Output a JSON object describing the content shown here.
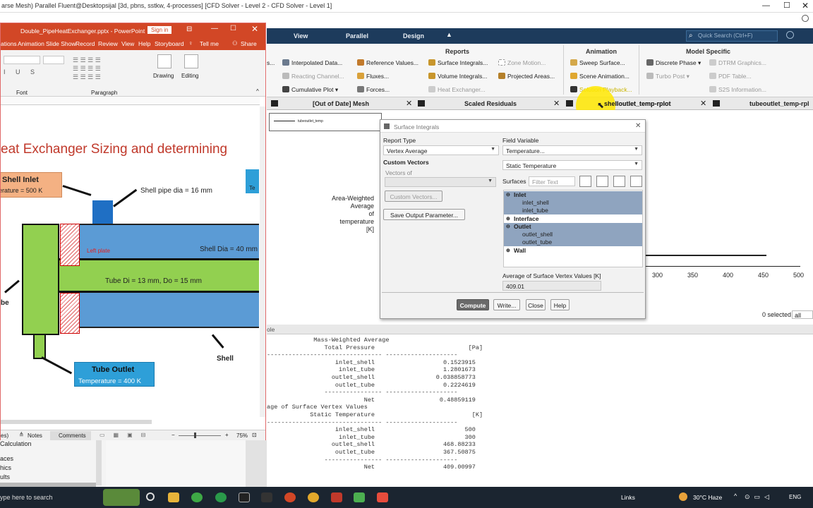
{
  "window_title": "arse Mesh) Parallel Fluent@Desktopsijal  [3d, pbns, sstkw, 4-processes] [CFD Solver - Level 2 - CFD Solver - Level 1]",
  "fluent": {
    "ribbon_tabs": [
      "View",
      "Parallel",
      "Design"
    ],
    "quick_search_placeholder": "Quick Search (Ctrl+F)",
    "groups": {
      "reports": "Reports",
      "animation": "Animation",
      "model_specific": "Model Specific"
    },
    "ribbon_items": {
      "interpolated_data": "Interpolated Data...",
      "reacting_channel": "Reacting Channel...",
      "cumulative_plot": "Cumulative Plot",
      "reference_values": "Reference Values...",
      "fluxes": "Fluxes...",
      "forces": "Forces...",
      "surface_integrals": "Surface Integrals...",
      "volume_integrals": "Volume Integrals...",
      "heat_exchanger": "Heat Exchanger...",
      "zone_motion": "Zone Motion...",
      "projected_areas": "Projected Areas...",
      "sweep_surface": "Sweep Surface...",
      "scene_animation": "Scene Animation...",
      "solution_playback": "Solution Playback...",
      "discrete_phase": "Discrete Phase",
      "turbo_post": "Turbo Post",
      "dtrm_graphics": "DTRM Graphics...",
      "pdf_table": "PDF Table...",
      "s2s_information": "S2S Information..."
    },
    "graphics_tabs": [
      "[Out of Date] Mesh",
      "Scaled Residuals",
      "shelloutlet_temp-rplot",
      "tubeoutlet_temp-rpl"
    ],
    "plot": {
      "legend_label": "tubeoutlet_temp",
      "ylabel_lines": [
        "Area-Weighted",
        "Average",
        "of",
        "temperature",
        "[K]"
      ],
      "x_ticks": [
        "300",
        "350",
        "400",
        "450",
        "500"
      ],
      "selected_text": "0 selected",
      "selected_filter": "all"
    },
    "console": {
      "header": "ole",
      "lines": [
        "             Mass-Weighted Average",
        "                Total Pressure                          [Pa]",
        "-------------------------------- --------------------",
        "                   inlet_shell                   0.1523915",
        "                    inlet_tube                   1.2801673",
        "                  outlet_shell                 0.038858773",
        "                   outlet_tube                   0.2224619",
        "                ---------------- --------------------",
        "                           Net                  0.48859119",
        "",
        "age of Surface Vertex Values",
        "            Static Temperature                           [K]",
        "-------------------------------- --------------------",
        "                   inlet_shell                         500",
        "                    inlet_tube                         300",
        "                  outlet_shell                   468.88233",
        "                   outlet_tube                   367.50875",
        "                ---------------- --------------------",
        "                           Net                   409.00997"
      ]
    }
  },
  "dialog": {
    "title": "Surface Integrals",
    "report_type_label": "Report Type",
    "report_type_value": "Vertex Average",
    "custom_vectors_label": "Custom Vectors",
    "vectors_of_label": "Vectors of",
    "custom_vectors_button": "Custom Vectors...",
    "save_output_button": "Save Output Parameter...",
    "field_variable_label": "Field Variable",
    "field_variable_value": "Temperature...",
    "field_sub_value": "Static Temperature",
    "surfaces_label": "Surfaces",
    "filter_placeholder": "Filter Text",
    "tree": [
      {
        "label": "Inlet",
        "group": true,
        "selected": true
      },
      {
        "label": "inlet_shell",
        "group": false,
        "selected": true
      },
      {
        "label": "inlet_tube",
        "group": false,
        "selected": true
      },
      {
        "label": "Interface",
        "group": true,
        "selected": false
      },
      {
        "label": "Outlet",
        "group": true,
        "selected": true
      },
      {
        "label": "outlet_shell",
        "group": false,
        "selected": true
      },
      {
        "label": "outlet_tube",
        "group": false,
        "selected": true
      },
      {
        "label": "Wall",
        "group": true,
        "selected": false
      }
    ],
    "result_label": "Average of Surface Vertex Values [K]",
    "result_value": "409.01",
    "buttons": {
      "compute": "Compute",
      "write": "Write...",
      "close": "Close",
      "help": "Help"
    }
  },
  "ppt": {
    "filename": "Double_PipeHeatExchanger.pptx  -  PowerPoint",
    "sign_in": "Sign in",
    "menu": [
      "ations",
      "Animation",
      "Slide Show",
      "Record",
      "Review",
      "View",
      "Help",
      "Storyboard",
      "Tell me",
      "Share"
    ],
    "ribbon_groups": {
      "font": "Font",
      "paragraph": "Paragraph",
      "drawing": "Drawing",
      "editing": "Editing"
    },
    "slide": {
      "title": "eat Exchanger Sizing and determining",
      "shell_inlet_title": "Shell Inlet",
      "shell_inlet_temp": "erature = 500 K",
      "shell_pipe_dia": "Shell pipe dia  = 16 mm",
      "left_plate": "Left plate",
      "shell_dia": "Shell Dia  = 40 mm",
      "tube_dims": "Tube Di = 13 mm, Do = 15 mm",
      "tube_label_left": "be",
      "tube_outlet_title": "Tube Outlet",
      "tube_outlet_temp": "Temperature = 400 K",
      "shell_label": "Shell",
      "te_box": "Te"
    },
    "status": {
      "notes": "Notes",
      "comments": "Comments",
      "zoom": "75%",
      "left": "es)"
    }
  },
  "left_tree": [
    "Calculation",
    "aces",
    "hics",
    "ults"
  ],
  "taskbar": {
    "search_text": "ype here to search",
    "links": "Links",
    "weather": "30°C  Haze",
    "lang": "ENG"
  },
  "colors": {
    "fluent_blue": "#1d3b5c",
    "ppt_red": "#d24726",
    "shell_blue": "#5b9bd5",
    "tube_green": "#92d050",
    "highlight_yellow": "#ffe800"
  }
}
